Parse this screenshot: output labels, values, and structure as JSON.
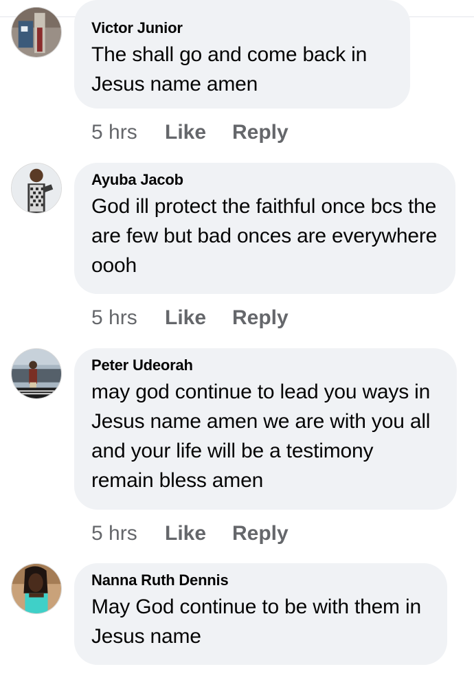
{
  "comments": [
    {
      "author": "Victor Junior",
      "text": "The shall go and come back in Jesus name amen",
      "time": "5 hrs",
      "like_label": "Like",
      "reply_label": "Reply"
    },
    {
      "author": "Ayuba Jacob",
      "text": "God ill protect the faithful once bcs the are few but bad onces are everywhere oooh",
      "time": "5 hrs",
      "like_label": "Like",
      "reply_label": "Reply"
    },
    {
      "author": "Peter Udeorah",
      "text": "may god continue to lead you ways in Jesus name amen we are with you all and your life will be a testimony remain bless amen",
      "time": "5 hrs",
      "like_label": "Like",
      "reply_label": "Reply"
    },
    {
      "author": "Nanna Ruth Dennis",
      "text": "May God continue to be with them in Jesus name"
    }
  ]
}
